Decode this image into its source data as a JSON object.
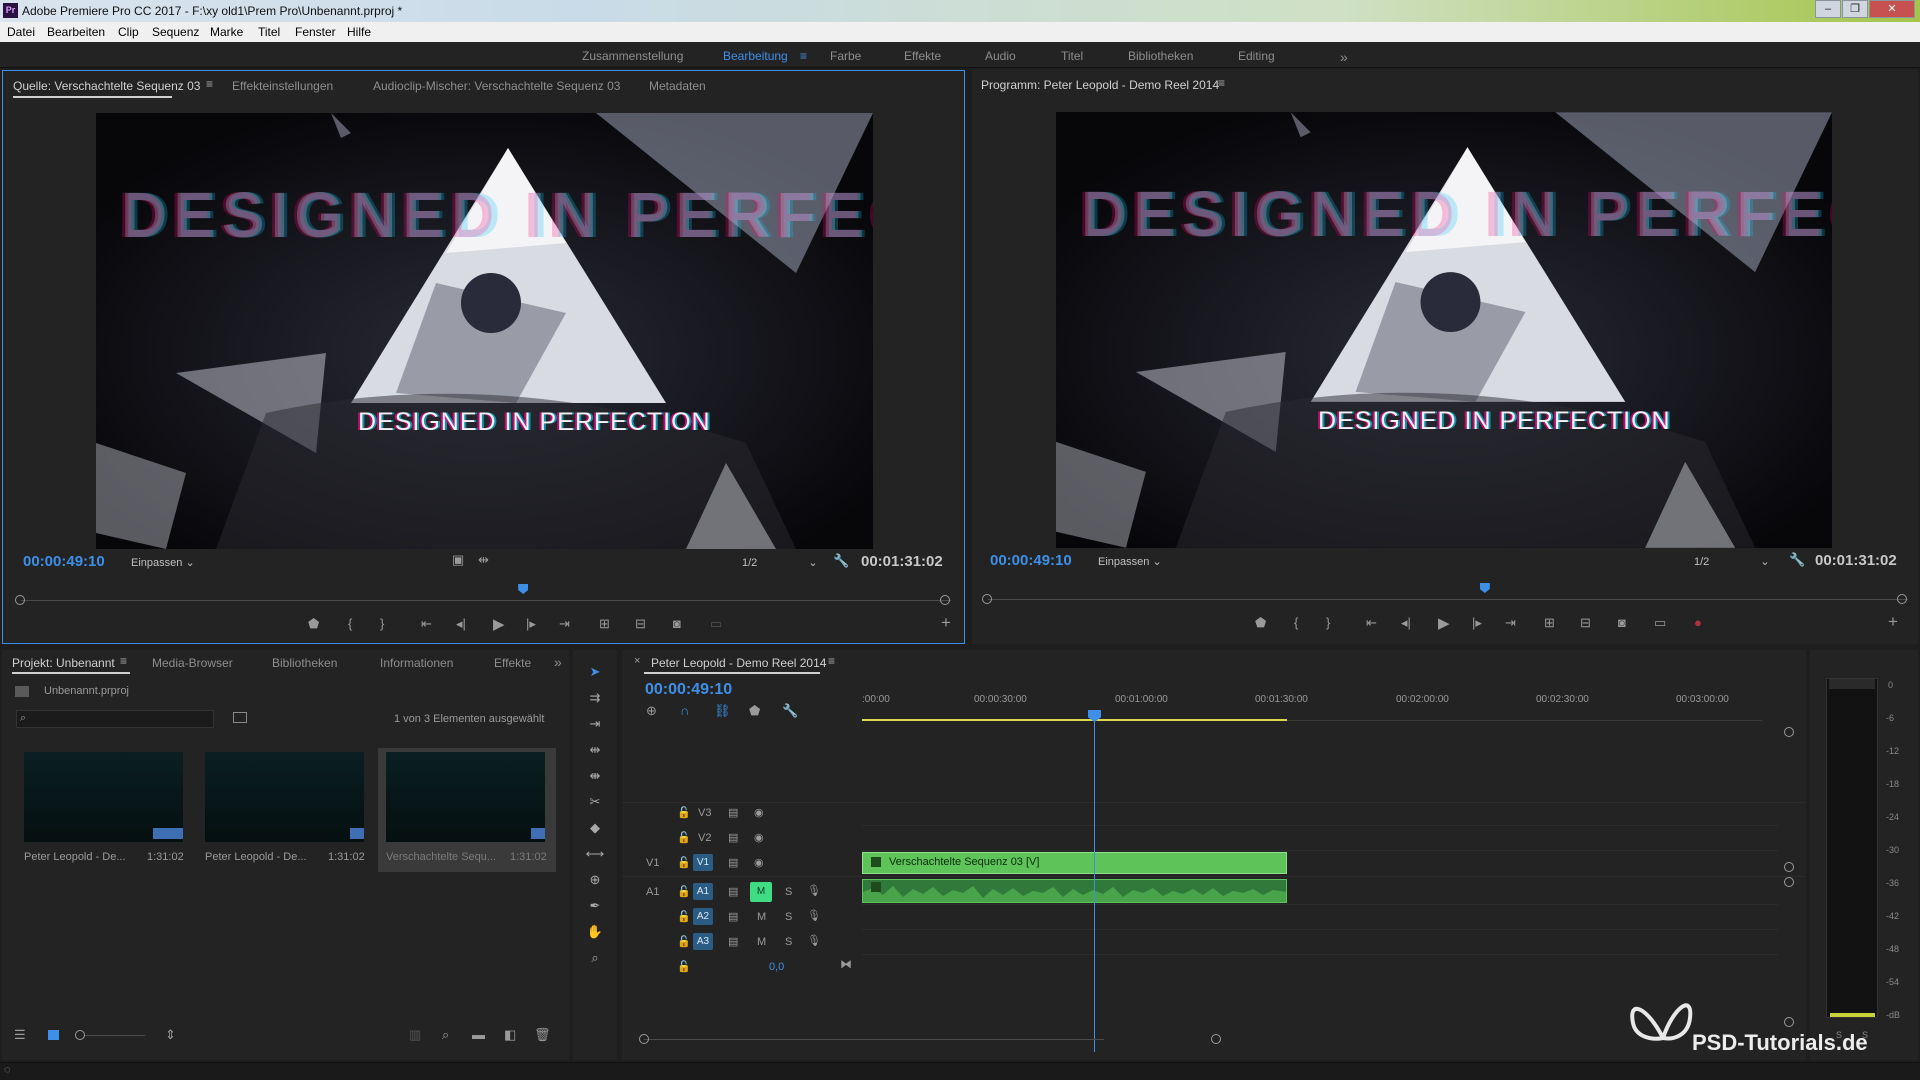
{
  "window": {
    "title": "Adobe Premiere Pro CC 2017 - F:\\xy old1\\Prem Pro\\Unbenannt.prproj *",
    "app_badge": "Pr"
  },
  "menu": [
    "Datei",
    "Bearbeiten",
    "Clip",
    "Sequenz",
    "Marke",
    "Titel",
    "Fenster",
    "Hilfe"
  ],
  "workspaces": {
    "items": [
      "Zusammenstellung",
      "Bearbeitung",
      "Farbe",
      "Effekte",
      "Audio",
      "Titel",
      "Bibliotheken",
      "Editing"
    ],
    "active": "Bearbeitung",
    "more": "»"
  },
  "source_monitor": {
    "tabs": [
      "Quelle: Verschachtelte Sequenz 03",
      "Effekteinstellungen",
      "Audioclip-Mischer: Verschachtelte Sequenz 03",
      "Metadaten"
    ],
    "timecode": "00:00:49:10",
    "fit": "Einpassen",
    "resolution": "1/2",
    "duration": "00:01:31:02",
    "overlay_title": "DESIGNED IN PERFECTION",
    "overlay_bg_text": "DESIGNED IN PERFEC",
    "playhead_fraction": 0.54
  },
  "program_monitor": {
    "tab": "Programm: Peter Leopold - Demo Reel 2014",
    "timecode": "00:00:49:10",
    "fit": "Einpassen",
    "resolution": "1/2",
    "duration": "00:01:31:02",
    "overlay_title": "DESIGNED IN PERFECTION",
    "overlay_bg_text": "DESIGNED IN PERFEC",
    "playhead_fraction": 0.54
  },
  "project": {
    "tabs": [
      "Projekt: Unbenannt",
      "Media-Browser",
      "Bibliotheken",
      "Informationen",
      "Effekte"
    ],
    "file": "Unbenannt.prproj",
    "selection_count": "1 von 3 Elementen ausgewählt",
    "items": [
      {
        "name": "Peter Leopold - De...",
        "duration": "1:31:02"
      },
      {
        "name": "Peter Leopold - De...",
        "duration": "1:31:02"
      },
      {
        "name": "Verschachtelte Sequ...",
        "duration": "1:31:02"
      }
    ]
  },
  "timeline": {
    "tab": "Peter Leopold - Demo Reel 2014",
    "timecode": "00:00:49:10",
    "ruler": [
      ":00:00",
      "00:00:30:00",
      "00:01:00:00",
      "00:01:30:00",
      "00:02:00:00",
      "00:02:30:00",
      "00:03:00:00"
    ],
    "video_tracks": [
      "V3",
      "V2",
      "V1"
    ],
    "audio_tracks": [
      "A1",
      "A2",
      "A3"
    ],
    "source_patch_video": "V1",
    "source_patch_audio": "A1",
    "mute_label": "M",
    "solo_label": "S",
    "master_value": "0,0",
    "video_clip": "Verschachtelte Sequenz 03 [V]"
  },
  "audio_meter": {
    "scale": [
      "0",
      "-6",
      "-12",
      "-18",
      "-24",
      "-30",
      "-36",
      "-42",
      "-48",
      "-54",
      "-dB"
    ],
    "footer": [
      "S",
      "S"
    ]
  },
  "watermark": "PSD-Tutorials.de",
  "colors": {
    "accent": "#3e8fe8",
    "clip_green": "#5ec45a",
    "timeline_bg": "#232323"
  }
}
